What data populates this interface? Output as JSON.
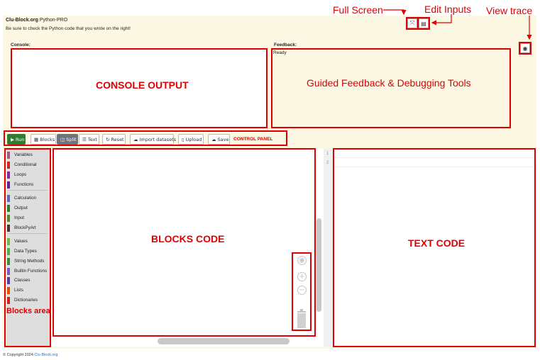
{
  "header": {
    "brand": "Clu-Block.org",
    "product": "Python-PRO",
    "subtitle": "Be sure to check the Python code that you wrote on the right!"
  },
  "console": {
    "label": "Console:"
  },
  "feedback": {
    "label": "Feedback:",
    "status": "Ready"
  },
  "toolbar": {
    "run": "Run",
    "blocks": "Blocks",
    "split": "Split",
    "text": "Text",
    "reset": "Reset",
    "import": "Import datasets",
    "upload": "Upload",
    "save": "Save",
    "panel_label": "CONTROL PANEL"
  },
  "toolbox": {
    "categories": [
      {
        "label": "Variables",
        "color": "#a55b80"
      },
      {
        "label": "Conditional",
        "color": "#c62828"
      },
      {
        "label": "Loops",
        "color": "#8e24aa"
      },
      {
        "label": "Functions",
        "color": "#6a1b9a"
      },
      {
        "label": "Calculation",
        "color": "#5c6bc0"
      },
      {
        "label": "Output",
        "color": "#2e7d32"
      },
      {
        "label": "Input",
        "color": "#558b2f"
      },
      {
        "label": "BlockPyArt",
        "color": "#4e342e"
      },
      {
        "label": "Values",
        "color": "#7cb342"
      },
      {
        "label": "Data Types",
        "color": "#4caf50"
      },
      {
        "label": "String Methods",
        "color": "#388e3c"
      },
      {
        "label": "Builtin Functions",
        "color": "#7e57c2"
      },
      {
        "label": "Classes",
        "color": "#5e35b1"
      },
      {
        "label": "Lists",
        "color": "#e65100"
      },
      {
        "label": "Dictionaries",
        "color": "#c62828"
      }
    ]
  },
  "editor": {
    "line_numbers": [
      "1",
      "2"
    ]
  },
  "annotations": {
    "full_screen": "Full Screen",
    "edit_inputs": "Edit Inputs",
    "view_trace": "View trace",
    "console_output": "CONSOLE OUTPUT",
    "guided_feedback": "Guided Feedback & Debugging Tools",
    "blocks_code": "BLOCKS CODE",
    "text_code": "TEXT CODE",
    "blocks_area": "Blocks area"
  },
  "footer": {
    "copyright": "© Copyright 2024",
    "link": "Clu-Block.org"
  },
  "colors": {
    "annotation_red": "#e00000",
    "run_green": "#2e7d32",
    "panel_bg": "#fcf8e3"
  }
}
